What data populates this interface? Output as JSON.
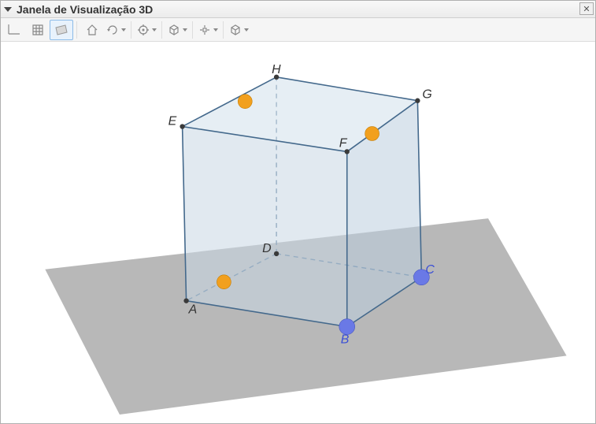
{
  "window": {
    "title": "Janela de Visualização 3D",
    "close_symbol": "✕"
  },
  "toolbar": {
    "axes_tip": "axes",
    "grid_tip": "grid",
    "plane_tip": "plane",
    "home_tip": "home",
    "rotate_tip": "rotate",
    "view_tip": "view direction",
    "clip_tip": "clipping",
    "proj_tip": "projection"
  },
  "cube": {
    "vertices": {
      "A": "A",
      "B": "B",
      "C": "C",
      "D": "D",
      "E": "E",
      "F": "F",
      "G": "G",
      "H": "H"
    }
  }
}
